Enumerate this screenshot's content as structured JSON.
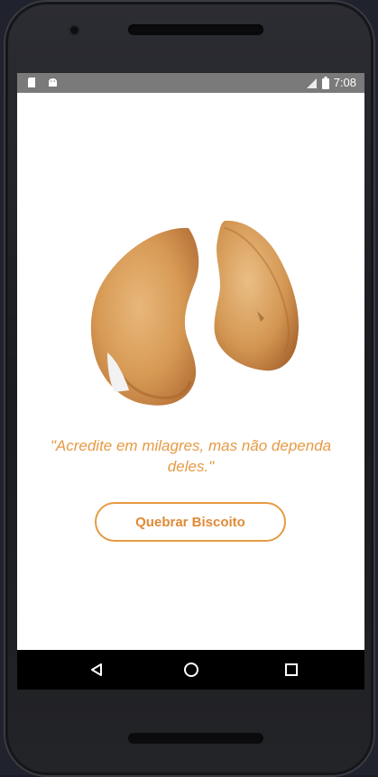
{
  "status_bar": {
    "time": "7:08",
    "left_icons": [
      "sd-card-icon",
      "android-icon"
    ],
    "right_icons": [
      "signal-icon",
      "battery-icon"
    ]
  },
  "app": {
    "image": "fortune-cookie-broken",
    "quote": "\"Acredite em milagres, mas não dependa deles.\"",
    "button_label": "Quebrar Biscoito",
    "accent_color": "#e69a44"
  },
  "nav_bar": {
    "buttons": [
      "back-icon",
      "home-icon",
      "recents-icon"
    ]
  }
}
